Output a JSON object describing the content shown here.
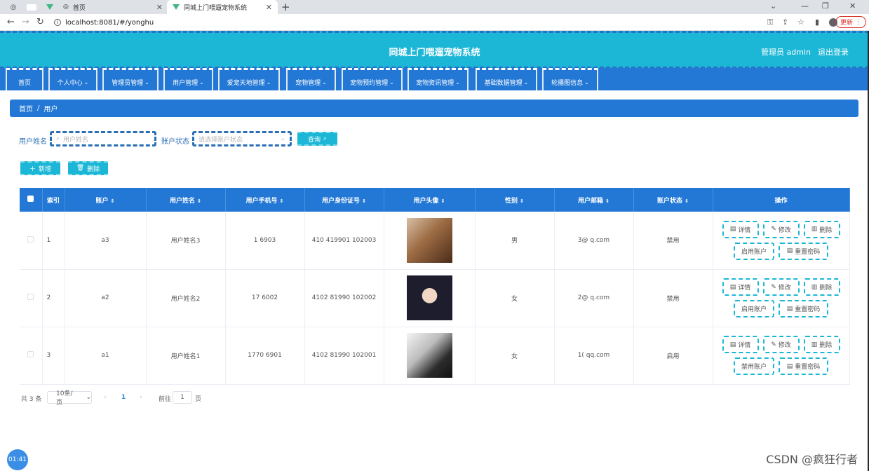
{
  "browser": {
    "tabs": [
      {
        "label": ""
      },
      {
        "label": "首页"
      },
      {
        "label": "同城上门喂遛宠物系统"
      }
    ],
    "url": "localhost:8081/#/yonghu",
    "update_label": "更新"
  },
  "header": {
    "title": "同城上门喂遛宠物系统",
    "user": "管理员 admin",
    "logout": "退出登录"
  },
  "nav": [
    {
      "label": "首页",
      "chevron": false
    },
    {
      "label": "个人中心",
      "chevron": true
    },
    {
      "label": "管理员管理",
      "chevron": true
    },
    {
      "label": "用户管理",
      "chevron": true
    },
    {
      "label": "爱宠天地管理",
      "chevron": true
    },
    {
      "label": "宠物管理",
      "chevron": true
    },
    {
      "label": "宠物预约管理",
      "chevron": true
    },
    {
      "label": "宠物资讯管理",
      "chevron": true
    },
    {
      "label": "基础数据管理",
      "chevron": true
    },
    {
      "label": "轮播图信息",
      "chevron": true
    }
  ],
  "breadcrumb": {
    "home": "首页",
    "sep": "/",
    "current": "用户"
  },
  "search": {
    "name_label": "用户姓名",
    "name_placeholder": "用户姓名",
    "status_label": "账户状态",
    "status_placeholder": "请选择账户状态",
    "query_label": "查询"
  },
  "actions": {
    "add": "新增",
    "delete": "删除"
  },
  "table": {
    "headers": {
      "index": "索引",
      "account": "账户",
      "name": "用户姓名",
      "phone": "用户手机号",
      "id_card": "用户身份证号",
      "avatar": "用户头像",
      "gender": "性别",
      "email": "用户邮箱",
      "status": "账户状态",
      "ops": "操作"
    },
    "rows": [
      {
        "index": "1",
        "account": "a3",
        "name": "用户姓名3",
        "phone": "1 6903",
        "id_card": "410 419901 102003",
        "avatar": "avatar-photo-1",
        "gender": "男",
        "email": "3@ q.com",
        "status": "禁用",
        "toggle": "启用账户"
      },
      {
        "index": "2",
        "account": "a2",
        "name": "用户姓名2",
        "phone": "17 6002",
        "id_card": "4102 81990 102002",
        "avatar": "avatar-photo-2",
        "gender": "女",
        "email": "2@ q.com",
        "status": "禁用",
        "toggle": "启用账户"
      },
      {
        "index": "3",
        "account": "a1",
        "name": "用户姓名1",
        "phone": "1770 6901",
        "id_card": "4102 81990 102001",
        "avatar": "avatar-photo-3",
        "gender": "女",
        "email": "1( qq.com",
        "status": "启用",
        "toggle": "禁用账户"
      }
    ],
    "op_labels": {
      "detail": "详情",
      "edit": "修改",
      "delete": "删除",
      "reset": "重置密码"
    }
  },
  "pagination": {
    "total": "共 3 条",
    "page_size": "10条/页",
    "current_page": "1",
    "goto_prefix": "前往",
    "goto_value": "1",
    "goto_suffix": "页"
  },
  "timer": "01:41",
  "watermark": "CSDN @疯狂行者"
}
